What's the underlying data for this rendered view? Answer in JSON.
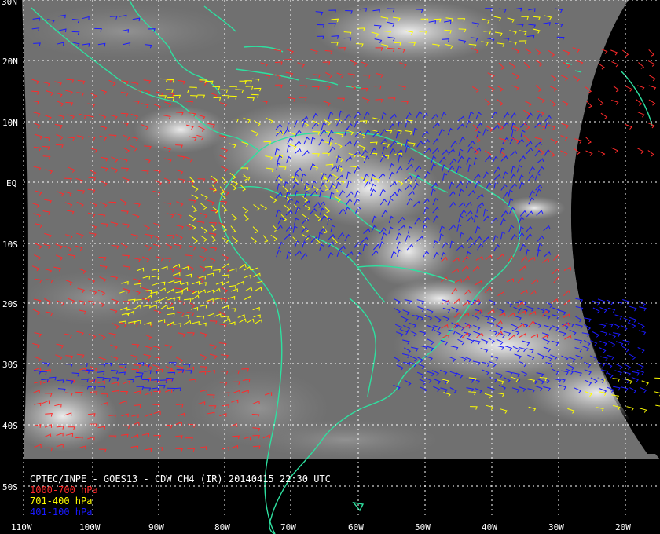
{
  "product": {
    "title": "CPTEC/INPE - GOES13 - CDW CH4 (IR) 20140415 22:30 UTC"
  },
  "legend": [
    {
      "label": "1000-700 hPa",
      "color": "#ff2a2a"
    },
    {
      "label": "701-400 hPa",
      "color": "#ffff00"
    },
    {
      "label": "401-100 hPa",
      "color": "#1a1aff"
    }
  ],
  "grid": {
    "lat_labels": [
      "30N",
      "20N",
      "10N",
      "EQ",
      "10S",
      "20S",
      "30S",
      "40S",
      "50S"
    ],
    "lon_labels": [
      "110W",
      "100W",
      "90W",
      "80W",
      "70W",
      "60W",
      "50W",
      "40W",
      "30W",
      "20W"
    ],
    "line_style": "dotted",
    "line_color": "#ffffff"
  },
  "colors": {
    "coastline": "#2ee0a0",
    "background": "#000000",
    "satellite_disk": "#6e6e6e"
  }
}
